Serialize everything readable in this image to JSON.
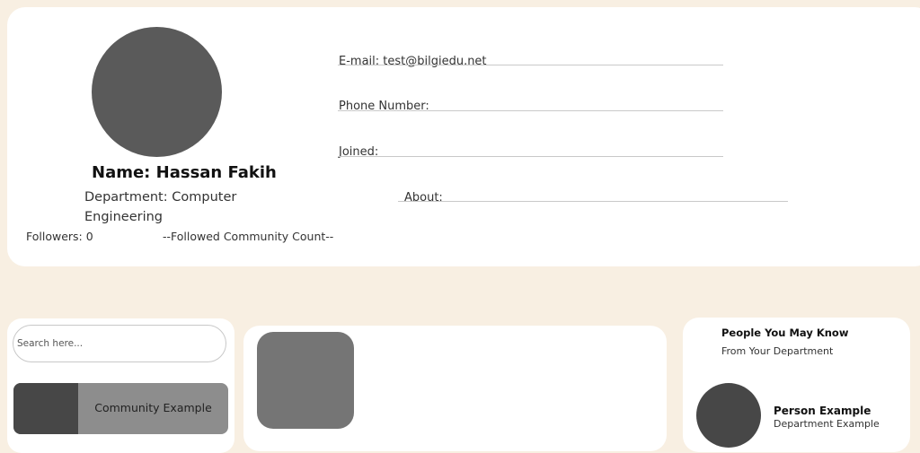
{
  "profile": {
    "name": "Name: Hassan Fakih",
    "department": "Department: Computer Engineering",
    "followers": "Followers: 0",
    "followed_community_count": "--Followed Community Count--",
    "email": "E-mail: test@bilgiedu.net",
    "phone": "Phone Number:",
    "joined": "Joined:",
    "about": "About:"
  },
  "search": {
    "placeholder": "Search here..."
  },
  "communities": [
    {
      "label": "Community Example"
    }
  ],
  "people": {
    "title": "People You May Know",
    "subtitle": "From Your Department",
    "items": [
      {
        "name": "Person Example",
        "department": "Department Example"
      }
    ]
  }
}
